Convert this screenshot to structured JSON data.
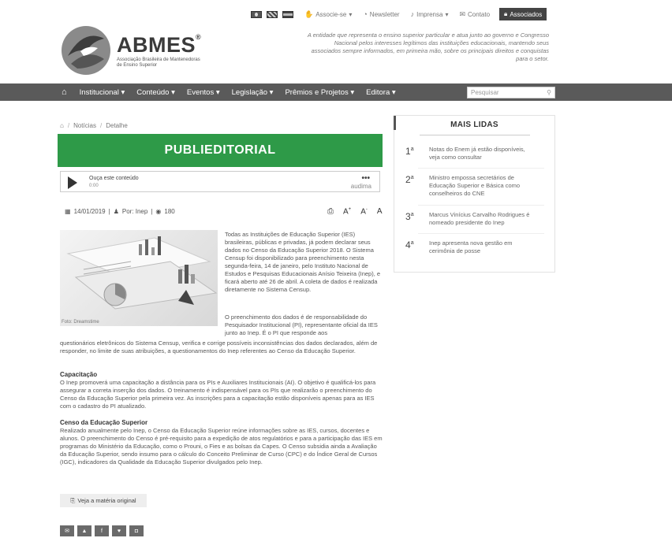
{
  "utility": {
    "flags": [
      "br-flag-icon",
      "uk-flag-icon",
      "es-flag-icon"
    ],
    "links": [
      {
        "icon": "handshake-icon",
        "label": "Associe-se"
      },
      {
        "icon": "rss-icon",
        "label": "Newsletter"
      },
      {
        "icon": "mic-icon",
        "label": "Imprensa"
      },
      {
        "icon": "mail-icon",
        "label": "Contato"
      }
    ],
    "associados_label": "Associados"
  },
  "logo": {
    "title": "ABMES",
    "sub": "Associação Brasileira de Mantenedoras de Ensino Superior"
  },
  "tagline": "A entidade que representa o ensino superior particular e atua junto ao governo e Congresso Nacional pelos interesses legítimos das instituições educacionais, mantendo seus associados sempre informados, em primeira mão, sobre os principais direitos e conquistas para o setor.",
  "nav": {
    "items": [
      "Institucional",
      "Conteúdo",
      "Eventos",
      "Legislação",
      "Prêmios e Projetos",
      "Editora"
    ],
    "search_placeholder": "Pesquisar"
  },
  "breadcrumb": [
    "Notícias",
    "Detalhe"
  ],
  "banner": "PUBLIEDITORIAL",
  "player": {
    "title": "Ouça este conteúdo",
    "time": "0:00",
    "dots": "•••",
    "brand": "audima"
  },
  "meta": {
    "date": "14/01/2019",
    "author": "Por: Inep",
    "views": "180"
  },
  "article": {
    "image_caption": "Foto: Dreamstime",
    "p1": "Todas as Instituições de Educação Superior (IES) brasileiras, públicas e privadas, já podem declarar seus dados no Censo da Educação Superior 2018. O Sistema Censup foi disponibilizado para preenchimento nesta segunda-feira, 14 de janeiro, pelo Instituto Nacional de Estudos e Pesquisas Educacionais Anísio Teixeira (Inep), e ficará aberto até 26 de abril. A coleta de dados é realizada diretamente no Sistema Censup.",
    "p2a": "O preenchimento dos dados é de responsabilidade do Pesquisador Institucional (PI), representante oficial da IES junto ao Inep. É o PI que responde aos",
    "p2b": "questionários eletrônicos do Sistema Censup, verifica e corrige possíveis inconsistências dos dados declarados, além de responder, no limite de suas atribuições, a questionamentos do Inep referentes ao Censo da Educação Superior.",
    "s1_title": "Capacitação",
    "s1_text": "O Inep promoverá uma capacitação a distância para os PIs e Auxiliares Institucionais (AI). O objetivo é qualificá-los para assegurar a correta inserção dos dados. O treinamento é indispensável para os PIs que realizarão o preenchimento do Censo da Educação Superior pela primeira vez. As inscrições para a capacitação estão disponíveis apenas para as IES com o cadastro do PI atualizado.",
    "s2_title": "Censo da Educação Superior",
    "s2_text": "Realizado anualmente pelo Inep, o Censo da Educação Superior reúne informações sobre as IES, cursos, docentes e alunos. O preenchimento do Censo é pré-requisito para a expedição de atos regulatórios e para a participação das IES em programas do Ministério da Educação, como o Prouni, o Fies e as bolsas da Capes. O Censo subsidia ainda a Avaliação da Educação Superior, sendo insumo para o cálculo do Conceito Preliminar de Curso (CPC) e do Índice Geral de Cursos (IGC), indicadores da Qualidade da Educação Superior divulgados pelo Inep.",
    "original_link": "Veja a matéria original"
  },
  "share": [
    "email-icon",
    "print-icon",
    "facebook-icon",
    "twitter-icon",
    "whatsapp-icon"
  ],
  "sidebar": {
    "title": "MAIS LIDAS",
    "items": [
      {
        "rank": "1",
        "text": "Notas do Enem já estão disponíveis, veja como consultar"
      },
      {
        "rank": "2",
        "text": "Ministro empossa secretários de Educação Superior e Básica como conselheiros do CNE"
      },
      {
        "rank": "3",
        "text": "Marcus Vinícius Carvalho Rodrigues é nomeado presidente do Inep"
      },
      {
        "rank": "4",
        "text": "Inep apresenta nova gestão em cerimônia de posse"
      }
    ]
  }
}
